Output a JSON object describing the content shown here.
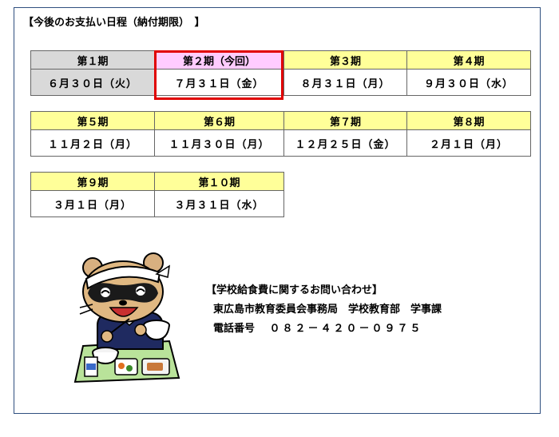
{
  "title": "【今後のお支払い日程（納付期限）　】",
  "row1": {
    "headers": [
      "第１期",
      "第２期（今回）",
      "第３期",
      "第４期"
    ],
    "dates": [
      "６月３０日（火）",
      "７月３１日（金）",
      "８月３１日（月）",
      "９月３０日（水）"
    ]
  },
  "row2": {
    "headers": [
      "第５期",
      "第６期",
      "第７期",
      "第８期"
    ],
    "dates": [
      "１１月２日（月）",
      "１１月３０日（月）",
      "１２月２５日（金）",
      "２月１日（月）"
    ]
  },
  "row3": {
    "headers": [
      "第９期",
      "第１０期"
    ],
    "dates": [
      "３月１日（月）",
      "３月３１日（水）"
    ]
  },
  "contact": {
    "heading": "【学校給食費に関するお問い合わせ】",
    "office": "東広島市教育委員会事務局　学校教育部　学事課",
    "phone_label": "電話番号",
    "phone_number": "０８２－４２０－０９７５"
  },
  "colors": {
    "header_yellow": "#ffff99",
    "past_gray": "#d9d9d9",
    "current_pink": "#ffccff",
    "current_border": "#e00000"
  },
  "mascot_icon": "tanuki-school-lunch-mascot"
}
